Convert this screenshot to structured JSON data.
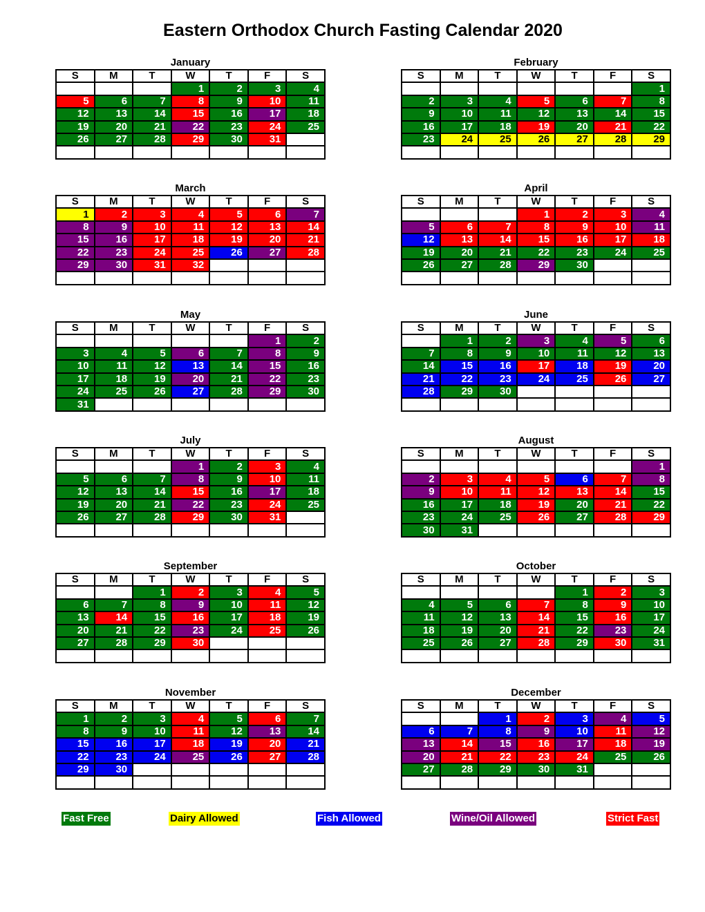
{
  "title": "Eastern Orthodox Church Fasting Calendar 2020",
  "weekday_headers": [
    "S",
    "M",
    "T",
    "W",
    "T",
    "F",
    "S"
  ],
  "colors": {
    "G": "#007A0C",
    "Y": "#FFFF00",
    "B": "#0000F0",
    "P": "#7A007E",
    "R": "#FF0000"
  },
  "text_colors": {
    "G": "#ffffff",
    "Y": "#000000",
    "B": "#ffffff",
    "P": "#ffffff",
    "R": "#ffffff"
  },
  "legend": [
    {
      "key": "G",
      "label": "Fast Free"
    },
    {
      "key": "Y",
      "label": "Dairy Allowed"
    },
    {
      "key": "B",
      "label": "Fish Allowed"
    },
    {
      "key": "P",
      "label": "Wine/Oil Allowed"
    },
    {
      "key": "R",
      "label": "Strict Fast"
    }
  ],
  "months": [
    {
      "name": "January",
      "start": 3,
      "days": "GGGGRGGRGRGGGGRGPGGGGPGRGGGGRGR"
    },
    {
      "name": "February",
      "start": 6,
      "days": "GGGGRGRGGGGGGGGGGGRGRGGYYYYYY"
    },
    {
      "name": "March",
      "start": 0,
      "days": "YRRRRRPPPRRRRRPPRRRRRPPRRBPRPPRR"
    },
    {
      "name": "April",
      "start": 3,
      "days": "RRRPPRRRRRPBRRRRRRGGGGGGGGGGPG"
    },
    {
      "name": "May",
      "start": 5,
      "days": "PGGGGPGPGGGGBGPGGGGPGPGGGGBGPGG"
    },
    {
      "name": "June",
      "start": 1,
      "days": "GGPGPGGGGGGGGGBBRBRBBBBBBRBBGG"
    },
    {
      "name": "July",
      "start": 3,
      "days": "PGRGGGGPGRGGGGRGPGGGGPGRGGGGRGR"
    },
    {
      "name": "August",
      "start": 6,
      "days": "PPRRRBRPPRRRRRGGGGRGRGGGGRGRRGG"
    },
    {
      "name": "September",
      "start": 2,
      "days": "GRGRGGGGPGRGGRGRGRGGGGPGRGGGGR"
    },
    {
      "name": "October",
      "start": 4,
      "days": "GRGGGGRGRGGGGRGRGGGGRGPGGGGRGRG"
    },
    {
      "name": "November",
      "start": 0,
      "days": "GGGRGRGGGGRGPGBBBRBRBBBBPBRBBB"
    },
    {
      "name": "December",
      "start": 2,
      "days": "BRBPBBBBPBRPPRPRPRPPRRRRGGGGGGG"
    }
  ]
}
